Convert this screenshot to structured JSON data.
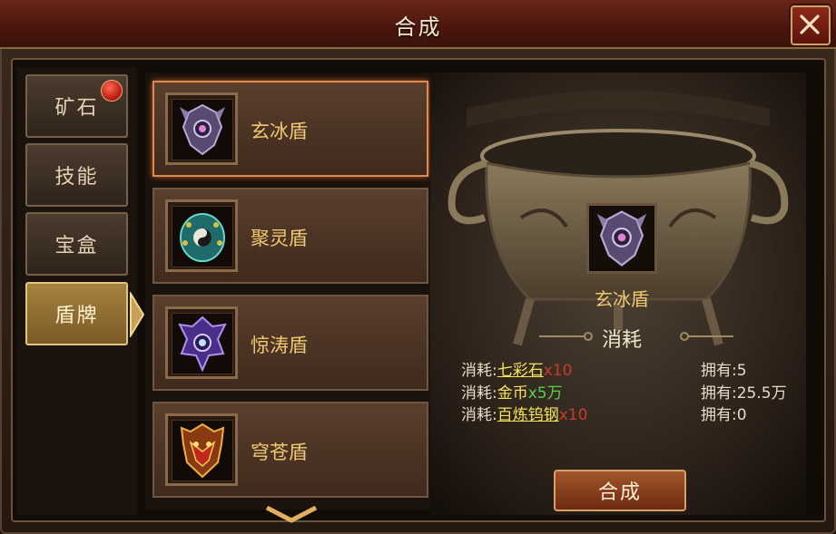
{
  "window": {
    "title": "合成"
  },
  "tabs": [
    {
      "label": "矿石",
      "badge": true
    },
    {
      "label": "技能",
      "badge": false
    },
    {
      "label": "宝盒",
      "badge": false
    },
    {
      "label": "盾牌",
      "badge": false,
      "active": true
    }
  ],
  "items": [
    {
      "name": "玄冰盾",
      "icon": "xuanbing-shield-icon",
      "selected": true
    },
    {
      "name": "聚灵盾",
      "icon": "juling-shield-icon"
    },
    {
      "name": "惊涛盾",
      "icon": "jingtao-shield-icon"
    },
    {
      "name": "穹苍盾",
      "icon": "qiongcang-shield-icon"
    }
  ],
  "detail": {
    "item_name": "玄冰盾",
    "cost_title": "消耗",
    "costs": [
      {
        "prefix": "消耗:",
        "material": "七彩石",
        "qty": "x10",
        "owned": "拥有:5"
      },
      {
        "prefix": "消耗:",
        "material": "金币",
        "qty": "x5万",
        "owned": "拥有:25.5万"
      },
      {
        "prefix": "消耗:",
        "material": "百炼钨钢",
        "qty": "x10",
        "owned": "拥有:0"
      }
    ],
    "button_label": "合成"
  },
  "colors": {
    "accent": "#f0c872",
    "title_bar": "#5a1a10",
    "sufficient": "#58d04a",
    "insufficient": "#c83a2a"
  }
}
